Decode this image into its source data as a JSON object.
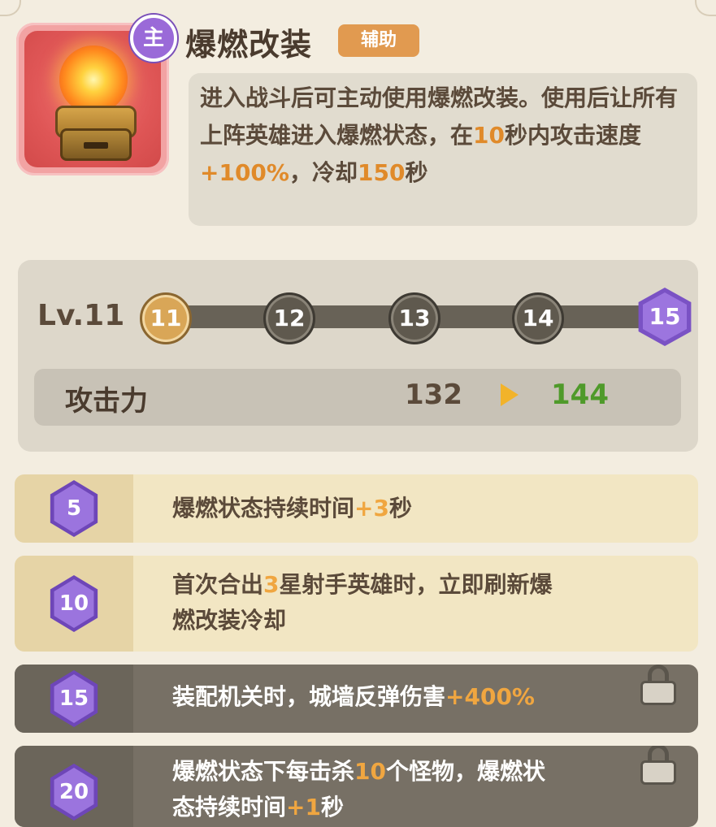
{
  "skill": {
    "main_badge": "主",
    "title": "爆燃改装",
    "tag": "辅助",
    "description_parts": [
      {
        "t": "进入战斗后可主动使用爆燃改装。使用后让所有上阵英雄进入爆燃状态，在",
        "hl": false
      },
      {
        "t": "10",
        "hl": true
      },
      {
        "t": "秒内攻击速度",
        "hl": false
      },
      {
        "t": "+100%",
        "hl": true
      },
      {
        "t": "，冷却",
        "hl": false
      },
      {
        "t": "150",
        "hl": true
      },
      {
        "t": "秒",
        "hl": false
      }
    ]
  },
  "level": {
    "label": "Lv.11",
    "nodes": [
      "11",
      "12",
      "13",
      "14"
    ],
    "max_node": "15",
    "current_index": 0
  },
  "stat": {
    "name": "攻击力",
    "current": "132",
    "next": "144"
  },
  "perks": [
    {
      "level": "5",
      "locked": false,
      "lines": [
        [
          {
            "t": "爆燃状态持续时间",
            "hl": false
          },
          {
            "t": "+3",
            "hl": true
          },
          {
            "t": "秒",
            "hl": false
          }
        ]
      ]
    },
    {
      "level": "10",
      "locked": false,
      "lines": [
        [
          {
            "t": "首次合出",
            "hl": false
          },
          {
            "t": "3",
            "hl": true
          },
          {
            "t": "星射手英雄时，立即刷新爆",
            "hl": false
          }
        ],
        [
          {
            "t": "燃改装冷却",
            "hl": false
          }
        ]
      ]
    },
    {
      "level": "15",
      "locked": true,
      "lines": [
        [
          {
            "t": "装配机关时，城墙反弹伤害",
            "hl": false
          },
          {
            "t": "+400%",
            "hl": true
          }
        ]
      ]
    },
    {
      "level": "20",
      "locked": true,
      "lines": [
        [
          {
            "t": "爆燃状态下每击杀",
            "hl": false
          },
          {
            "t": "10",
            "hl": true
          },
          {
            "t": "个怪物，爆燃状",
            "hl": false
          }
        ],
        [
          {
            "t": "态持续时间",
            "hl": false
          },
          {
            "t": "+1",
            "hl": true
          },
          {
            "t": "秒",
            "hl": false
          }
        ]
      ]
    }
  ],
  "icons": {
    "skill_icon": "flame-orb-pedestal-icon",
    "lock_icon": "padlock-icon",
    "arrow_icon": "play-arrow-icon"
  },
  "colors": {
    "highlight": "#e08a2a",
    "stat_next": "#4f9a2a",
    "hex_purple": "#9c75df",
    "current_node": "#d9a657"
  }
}
